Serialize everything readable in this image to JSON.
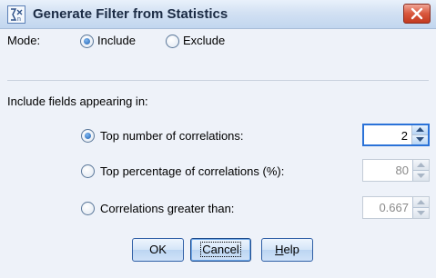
{
  "window": {
    "title": "Generate Filter from Statistics",
    "icon": "stats-filter-icon",
    "close_icon": "close-icon"
  },
  "mode": {
    "label": "Mode:",
    "options": [
      {
        "label": "Include",
        "checked": true
      },
      {
        "label": "Exclude",
        "checked": false
      }
    ]
  },
  "section_label": "Include fields appearing in:",
  "criteria": [
    {
      "label": "Top number of correlations:",
      "checked": true,
      "value": "2",
      "enabled": true
    },
    {
      "label": "Top percentage of correlations (%):",
      "checked": false,
      "value": "80",
      "enabled": false
    },
    {
      "label": "Correlations greater than:",
      "checked": false,
      "value": "0.667",
      "enabled": false
    }
  ],
  "buttons": {
    "ok": "OK",
    "cancel": "Cancel",
    "help_mnemonic": "H",
    "help_rest": "elp"
  },
  "colors": {
    "accent": "#2a72d8",
    "close_red": "#c23a1f",
    "background": "#eef2f9"
  }
}
